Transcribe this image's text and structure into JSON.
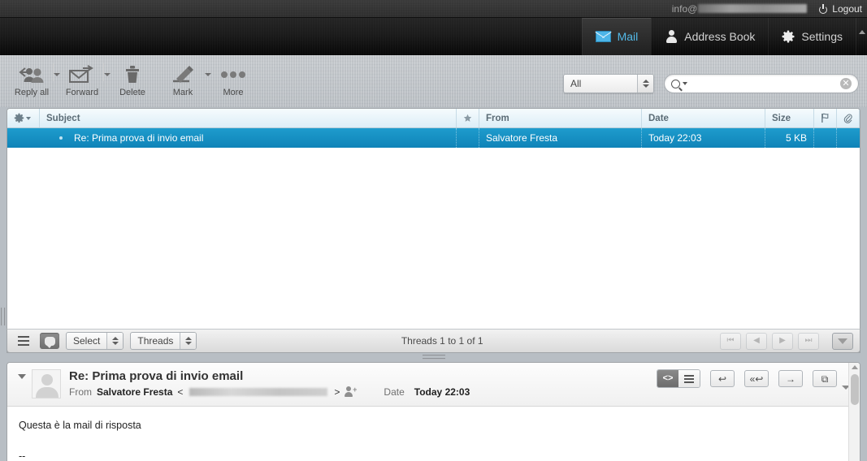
{
  "topline": {
    "user_prefix": "info@",
    "logout_label": "Logout",
    "power_icon": "power-icon"
  },
  "taskbar": {
    "tasks": [
      {
        "label": "Mail",
        "icon": "envelope-icon",
        "selected": true
      },
      {
        "label": "Address Book",
        "icon": "person-icon",
        "selected": false
      },
      {
        "label": "Settings",
        "icon": "gear-icon",
        "selected": false
      }
    ],
    "collapse_icon": "chevron-up-icon"
  },
  "toolbar": {
    "buttons": [
      {
        "label": "Reply all",
        "icon": "reply-all-icon",
        "has_menu": true
      },
      {
        "label": "Forward",
        "icon": "forward-icon",
        "has_menu": true
      },
      {
        "label": "Delete",
        "icon": "trash-icon",
        "has_menu": false
      },
      {
        "label": "Mark",
        "icon": "pencil-icon",
        "has_menu": true
      },
      {
        "label": "More",
        "icon": "ellipsis-icon",
        "has_menu": false
      }
    ]
  },
  "search": {
    "scope_label": "All",
    "input_value": "",
    "placeholder": "",
    "search_icon": "magnifier-icon",
    "clear_icon": "clear-icon"
  },
  "message_list": {
    "columns": {
      "options": "options-gear-icon",
      "subject": "Subject",
      "star": "star-icon",
      "from": "From",
      "date": "Date",
      "size": "Size",
      "flag": "flag-icon",
      "attachment": "paperclip-icon"
    },
    "rows": [
      {
        "subject": "Re: Prima prova di invio email",
        "from": "Salvatore Fresta",
        "date": "Today 22:03",
        "size": "5 KB",
        "selected": true,
        "unread_dot": true
      }
    ]
  },
  "list_footer": {
    "view_mode_icon": "list-lines-icon",
    "thread_mode_icon": "bubble-icon",
    "select_label": "Select",
    "threads_label": "Threads",
    "count_text": "Threads 1 to 1 of 1",
    "pager": [
      {
        "name": "first-page",
        "glyph": "⏮",
        "disabled": true
      },
      {
        "name": "prev-page",
        "glyph": "◀",
        "disabled": true
      },
      {
        "name": "next-page",
        "glyph": "▶",
        "disabled": true
      },
      {
        "name": "last-page",
        "glyph": "⏭",
        "disabled": true
      }
    ],
    "options_icon": "list-options-icon"
  },
  "preview": {
    "subject": "Re: Prima prova di invio email",
    "from_key": "From",
    "from_name": "Salvatore Fresta",
    "from_open": "<",
    "from_close": ">",
    "add_contact_icon": "add-contact-icon",
    "date_key": "Date",
    "date_value": "Today 22:03",
    "body": "Questa è la mail di risposta\n\n--",
    "toolbar": {
      "source_icon": "code-view-icon",
      "list_icon": "list-view-icon",
      "reply_icon": "reply-icon",
      "reply_all_icon": "reply-all-icon",
      "forward_icon": "forward-arrow-icon",
      "open_window_icon": "open-in-window-icon"
    },
    "expand_icon": "chevron-down-icon",
    "collapse_icon": "chevron-down-icon"
  },
  "colors": {
    "accent_blue": "#1e9ccd",
    "task_active": "#53b9e8",
    "header_gradient_top": "#f6fbfd",
    "header_gradient_bottom": "#dceef7"
  }
}
